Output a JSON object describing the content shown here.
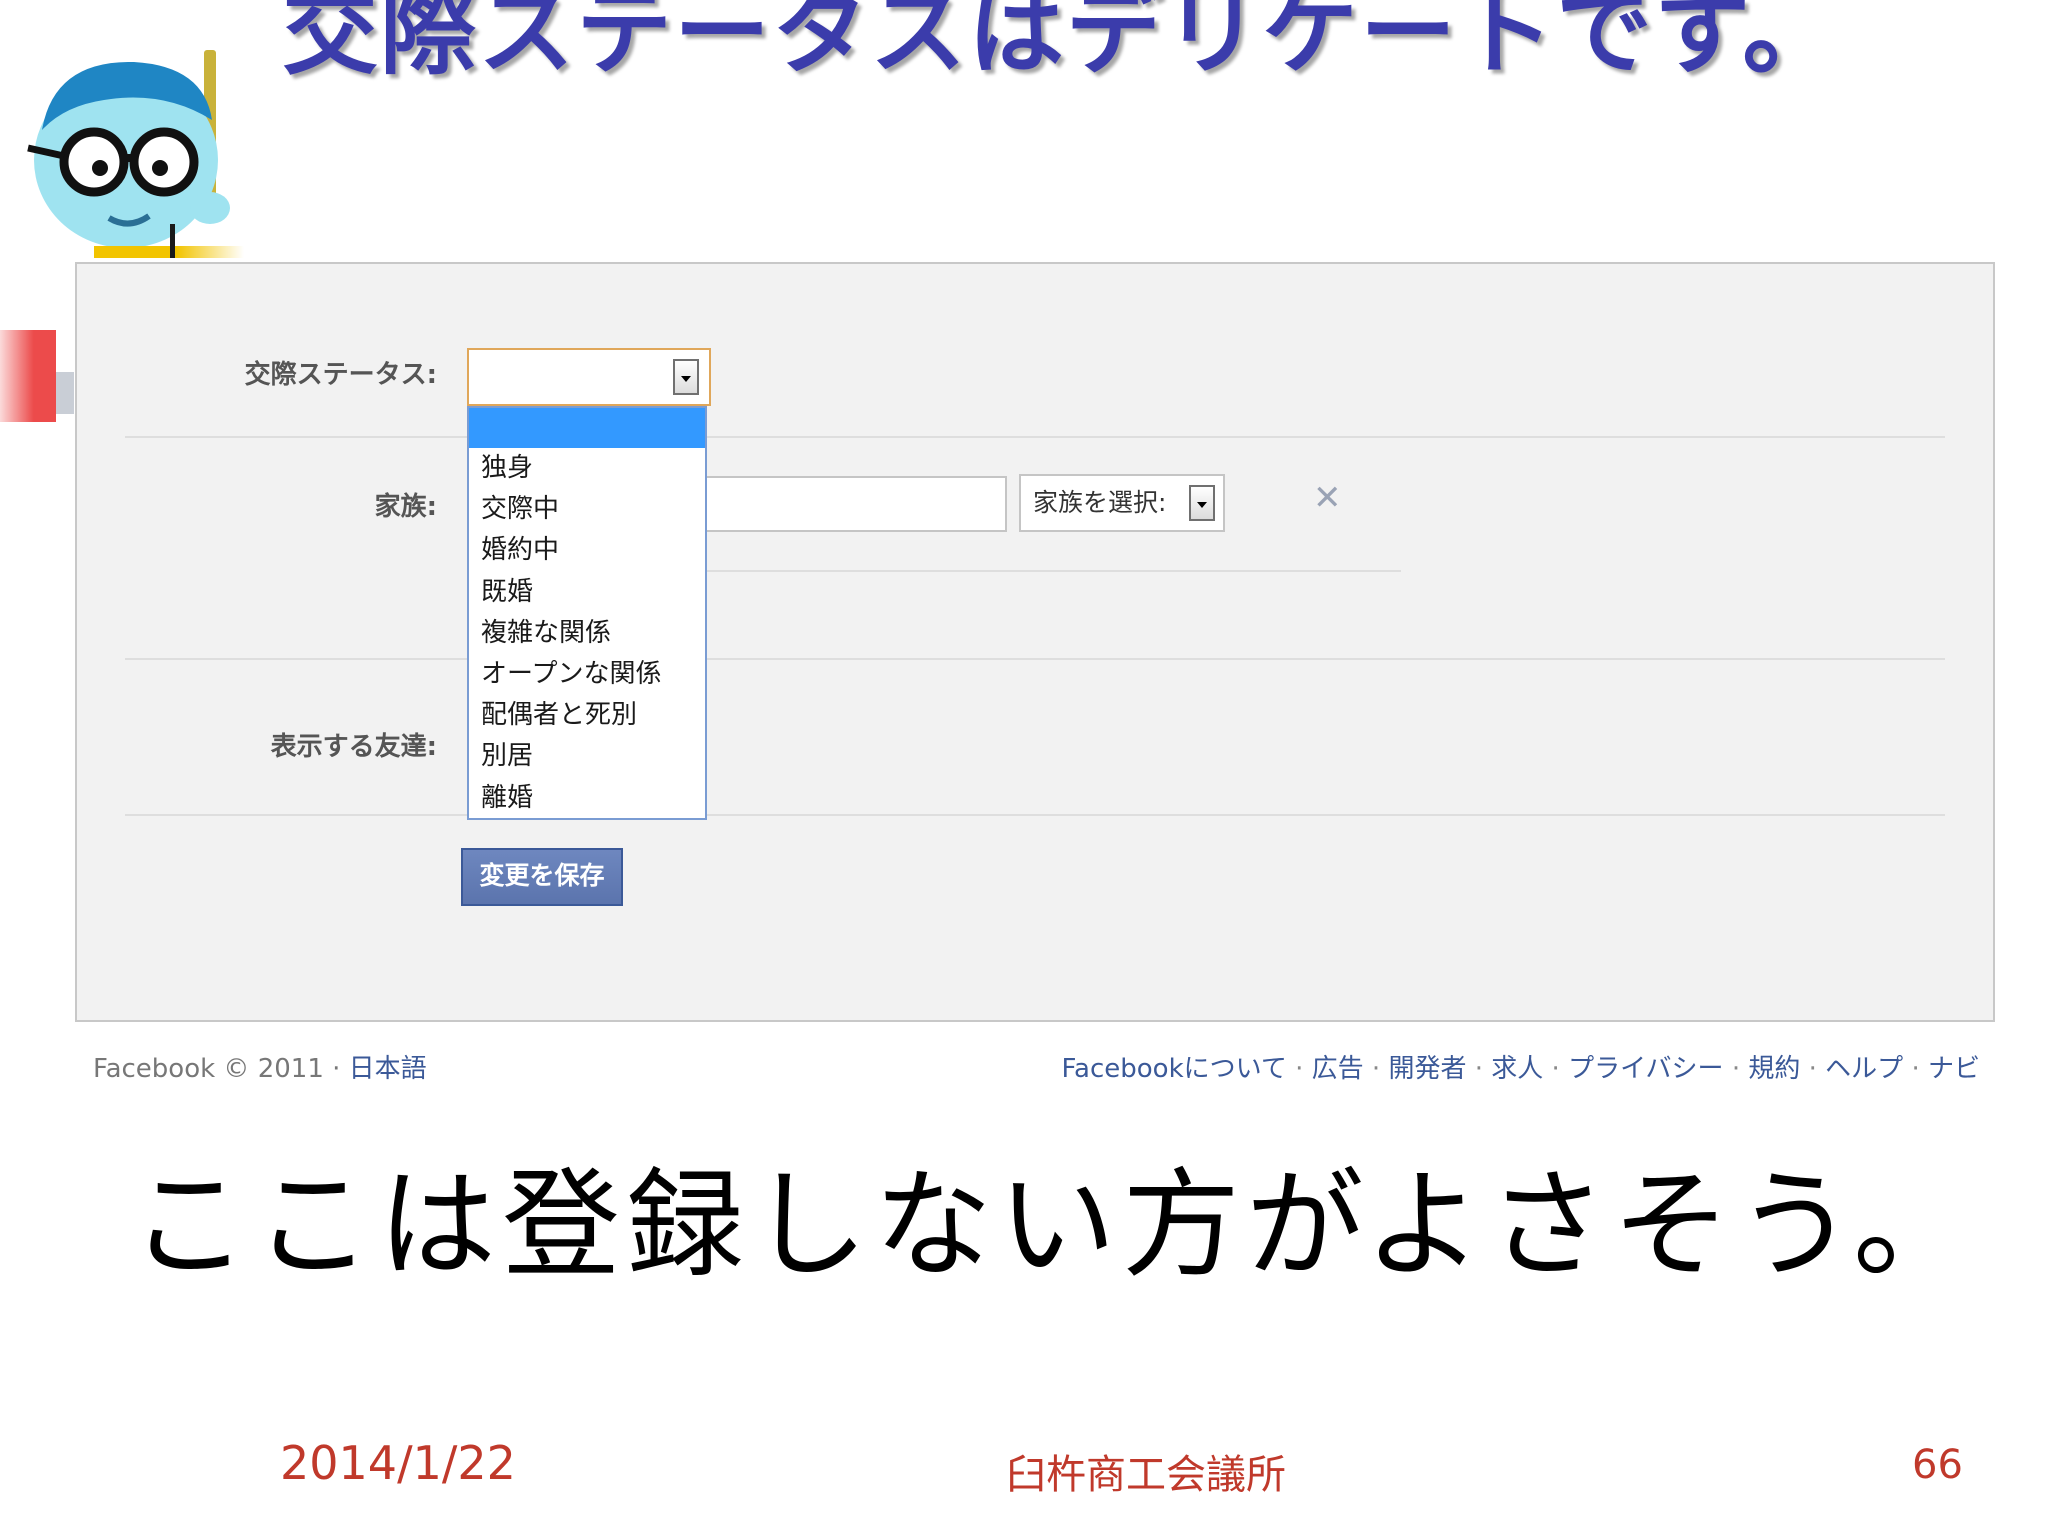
{
  "slide": {
    "title": "交際ステータスはデリケートです。",
    "caption": "ここは登録しない方がよさそう。",
    "date": "2014/1/22",
    "organization": "臼杵商工会議所",
    "page_number": "66"
  },
  "form": {
    "relationship_label": "交際ステータス:",
    "relationship_selected": "",
    "relationship_options": [
      "独身",
      "交際中",
      "婚約中",
      "既婚",
      "複雑な関係",
      "オープンな関係",
      "配偶者と死別",
      "別居",
      "離婚"
    ],
    "family_label": "家族:",
    "family_select_label": "家族を選択:",
    "friends_label": "表示する友達:",
    "save_button": "変更を保存"
  },
  "fb_footer": {
    "copyright": "Facebook © 2011 · ",
    "language": "日本語",
    "links": [
      "Facebookについて",
      "広告",
      "開発者",
      "求人",
      "プライバシー",
      "規約",
      "ヘルプ",
      "ナビ"
    ]
  },
  "colors": {
    "title": "#3b3cab",
    "footer_text": "#c0392b",
    "fb_link": "#3b5998",
    "dropdown_highlight": "#3399ff"
  }
}
